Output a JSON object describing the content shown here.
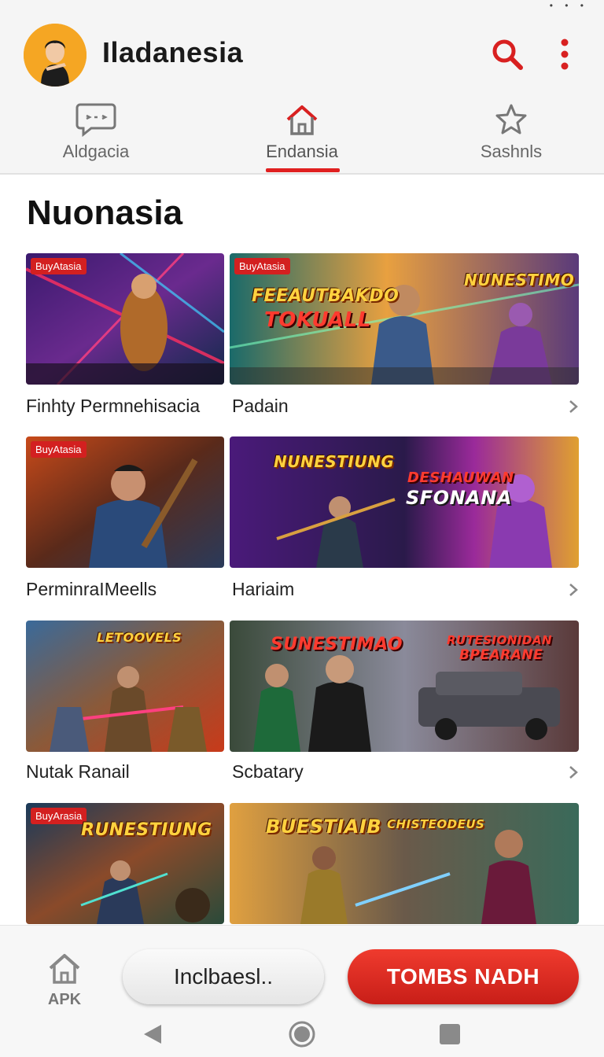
{
  "header": {
    "title": "Iladanesia",
    "status_dots": "• • •"
  },
  "tabs": [
    {
      "label": "Aldgacia",
      "icon": "chat-icon",
      "active": false
    },
    {
      "label": "Endansia",
      "icon": "home-icon",
      "active": true
    },
    {
      "label": "Sashnls",
      "icon": "star-icon",
      "active": false
    }
  ],
  "section": {
    "title": "Nuonasia"
  },
  "rows": [
    {
      "left": {
        "label": "Finhty Permnehisacia",
        "badge": "BuyAtasia"
      },
      "right": {
        "label": "Padain",
        "badge": "BuyAtasia",
        "banner1": "FEEAUTBAKDO",
        "banner2": "TOKUALL",
        "banner3": "NUNESTIMO"
      }
    },
    {
      "left": {
        "label": "PerminraIMeells",
        "badge": "BuyAtasia"
      },
      "right": {
        "label": "Hariaim",
        "banner1": "NUNESTIUNG",
        "banner2": "DESHAUWAN",
        "banner3": "SFONANA"
      }
    },
    {
      "left": {
        "label": "Nutak Ranail",
        "banner1": "LETOOVELS"
      },
      "right": {
        "label": "Scbatary",
        "banner1": "SUNESTIMAO",
        "banner2": "RUTESIONIDAN",
        "banner3": "BPEARANE"
      }
    },
    {
      "left": {
        "badge": "BuyArasia",
        "banner1": "RUNESTIUNG"
      },
      "right": {
        "banner1": "BUESTIAIB",
        "banner2": "CHISTEODEUS"
      }
    }
  ],
  "bottom": {
    "apk_label": "APK",
    "secondary_button": "Inclbaesl..",
    "primary_button": "TOMBS NADH"
  },
  "colors": {
    "accent": "#e02020",
    "avatar_bg": "#f5a623",
    "header_bg": "#f5f5f5"
  }
}
